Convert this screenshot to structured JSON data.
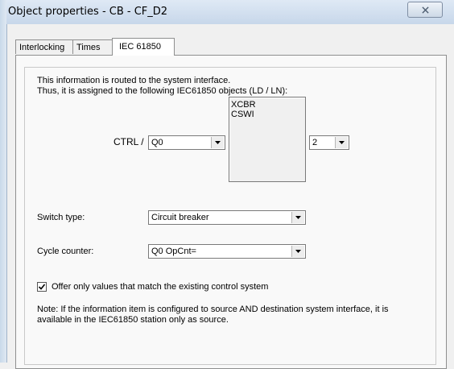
{
  "window": {
    "title": "Object properties - CB - CF_D2"
  },
  "tabs": [
    {
      "label": "Interlocking"
    },
    {
      "label": "Times"
    },
    {
      "label": "IEC 61850"
    }
  ],
  "iec": {
    "info_line1": "This information is routed to the system interface.",
    "info_line2": "Thus, it is assigned to the following IEC61850 objects (LD / LN):",
    "ctrl_label": "CTRL /",
    "ld_value": "Q0",
    "ln_list": [
      "XCBR",
      "CSWI"
    ],
    "instance_value": "2",
    "switch_type_label": "Switch type:",
    "switch_type_value": "Circuit breaker",
    "cycle_counter_label": "Cycle counter:",
    "cycle_counter_value": "Q0 OpCnt=",
    "offer_only_label": "Offer only values that match the existing control system",
    "offer_only_checked": true,
    "note_line1": "Note: If the information item is configured to source AND destination system interface, it is",
    "note_line2": "available in the IEC61850 station only as source."
  },
  "icons": {
    "close": "close-x-icon",
    "dropdown": "chevron-down-icon",
    "check": "checkmark-icon"
  }
}
